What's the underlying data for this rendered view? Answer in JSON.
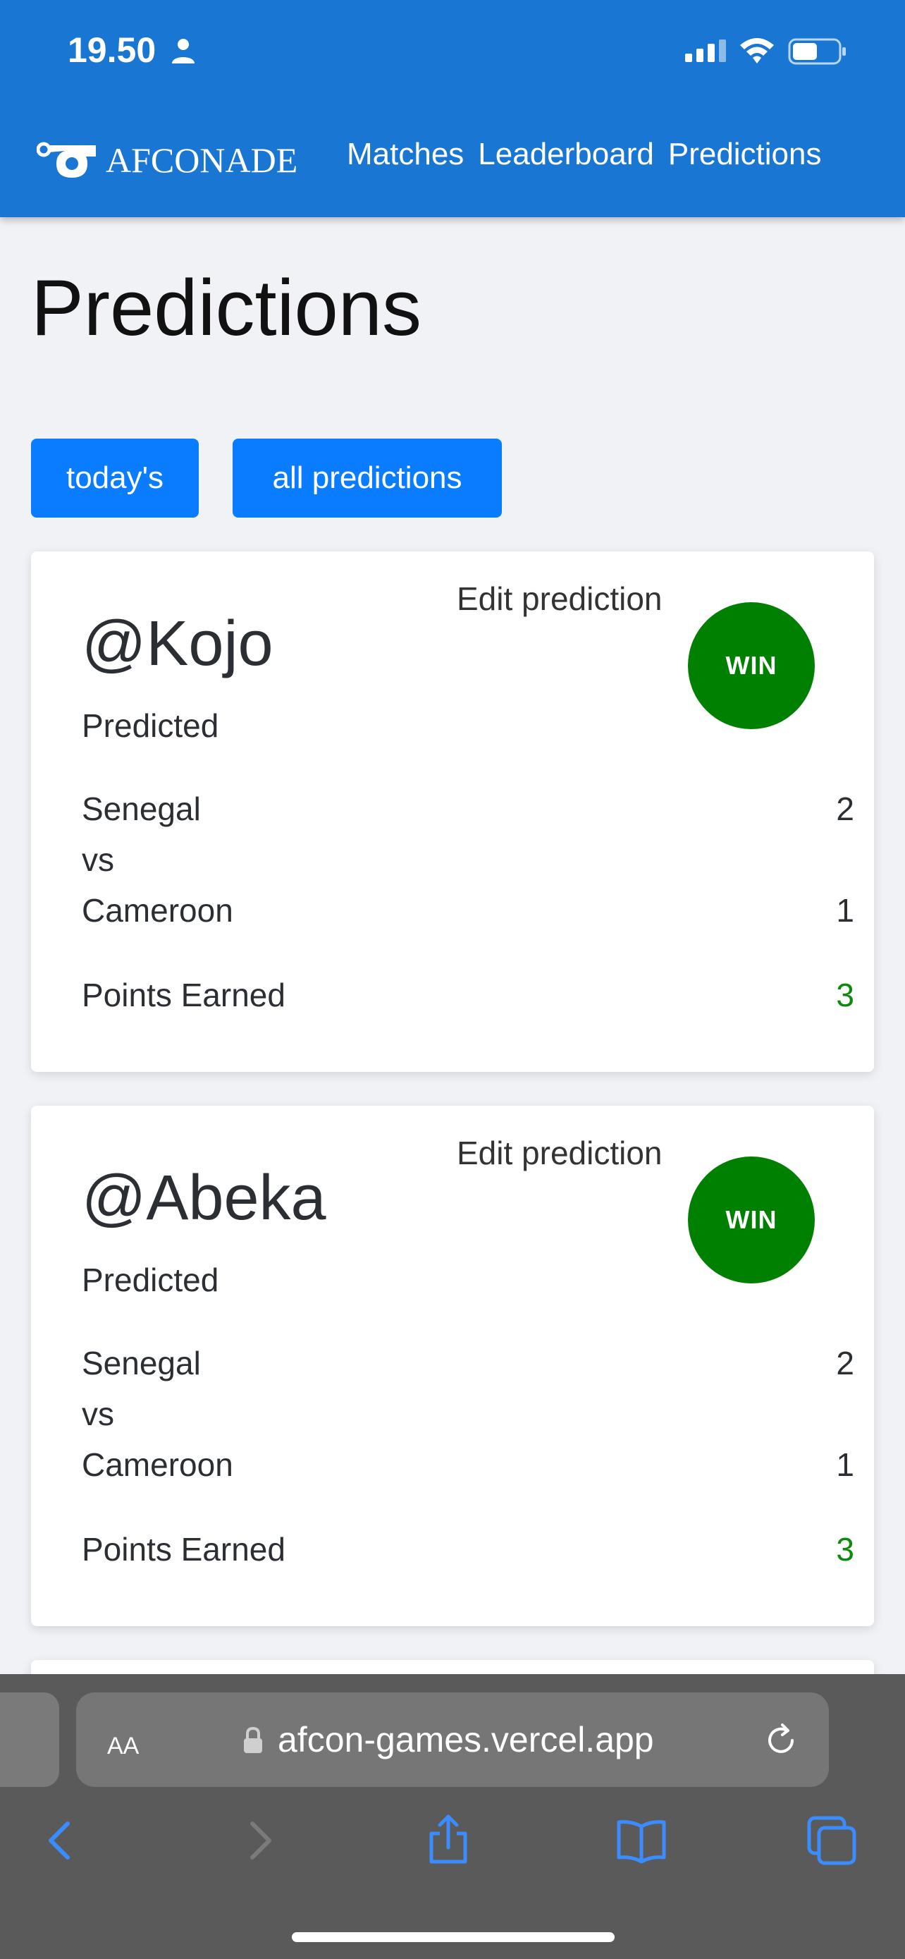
{
  "status_bar": {
    "time": "19.50"
  },
  "header": {
    "brand": "AFCONADE",
    "nav": [
      {
        "label": "Matches"
      },
      {
        "label": "Leaderboard"
      },
      {
        "label": "Predictions"
      }
    ]
  },
  "page": {
    "title": "Predictions",
    "filters": {
      "today_label": "today's",
      "all_label": "all predictions"
    }
  },
  "predictions": [
    {
      "edit_label": "Edit prediction",
      "user": "@Kojo",
      "result": "WIN",
      "predicted_label": "Predicted",
      "home_team": "Senegal",
      "home_score": "2",
      "vs_label": "vs",
      "away_team": "Cameroon",
      "away_score": "1",
      "points_label": "Points Earned",
      "points": "3"
    },
    {
      "edit_label": "Edit prediction",
      "user": "@Abeka",
      "result": "WIN",
      "predicted_label": "Predicted",
      "home_team": "Senegal",
      "home_score": "2",
      "vs_label": "vs",
      "away_team": "Cameroon",
      "away_score": "1",
      "points_label": "Points Earned",
      "points": "3"
    }
  ],
  "browser": {
    "aa_label": "AA",
    "url": "afcon-games.vercel.app"
  },
  "colors": {
    "header_bg": "#1976d2",
    "button_bg": "#0a7cff",
    "win_badge": "#008000",
    "points": "#0b8a0b"
  }
}
